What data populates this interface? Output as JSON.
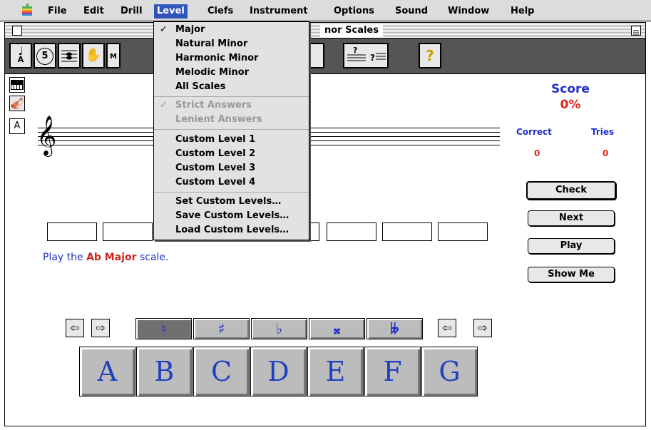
{
  "menubar": {
    "apple_icon": "apple-icon",
    "items": [
      "File",
      "Edit",
      "Drill",
      "Level",
      "Clefs",
      "Instrument",
      "Options",
      "Sound",
      "Window",
      "Help"
    ],
    "selected": "Level"
  },
  "window": {
    "title_fragment": "nor Scales",
    "toolbar_buttons": [
      "note-name-icon",
      "interval-icon",
      "chord-icon",
      "hand-icon",
      "key-signature-icon",
      "scale-icon",
      "tuning-icon",
      "help-icon"
    ],
    "toolbar_glyphs": {
      "note_letter": "A",
      "circle_num": "5",
      "help": "?"
    }
  },
  "sidebar": {
    "keyboard": "keyboard-icon",
    "violin": "violin-icon",
    "letter": "A"
  },
  "instruction": {
    "prefix": "Play the ",
    "highlight": "Ab Major",
    "suffix": " scale."
  },
  "score": {
    "title": "Score",
    "value": "0%",
    "correct_label": "Correct",
    "tries_label": "Tries",
    "correct": "0",
    "tries": "0"
  },
  "buttons": {
    "check": "Check",
    "next": "Next",
    "play": "Play",
    "show_me": "Show Me"
  },
  "accidentals": [
    "♮",
    "♯",
    "♭",
    "𝄪",
    "𝄫"
  ],
  "accidental_selected": 0,
  "arrows": {
    "left": "⇦",
    "right": "⇨"
  },
  "notes": [
    "A",
    "B",
    "C",
    "D",
    "E",
    "F",
    "G"
  ],
  "level_menu": {
    "items": [
      {
        "label": "Major",
        "checked": true,
        "disabled": false
      },
      {
        "label": "Natural Minor",
        "checked": false,
        "disabled": false
      },
      {
        "label": "Harmonic Minor",
        "checked": false,
        "disabled": false
      },
      {
        "label": "Melodic Minor",
        "checked": false,
        "disabled": false
      },
      {
        "label": "All Scales",
        "checked": false,
        "disabled": false
      },
      {
        "label": "Strict Answers",
        "checked": true,
        "disabled": true
      },
      {
        "label": "Lenient Answers",
        "checked": false,
        "disabled": true
      },
      {
        "label": "Custom Level  1",
        "checked": false,
        "disabled": false
      },
      {
        "label": "Custom Level  2",
        "checked": false,
        "disabled": false
      },
      {
        "label": "Custom Level  3",
        "checked": false,
        "disabled": false
      },
      {
        "label": "Custom Level  4",
        "checked": false,
        "disabled": false
      },
      {
        "label": "Set Custom Levels…",
        "checked": false,
        "disabled": false
      },
      {
        "label": "Save Custom Levels…",
        "checked": false,
        "disabled": false
      },
      {
        "label": "Load Custom Levels…",
        "checked": false,
        "disabled": false
      }
    ],
    "checkmark": "✓"
  }
}
